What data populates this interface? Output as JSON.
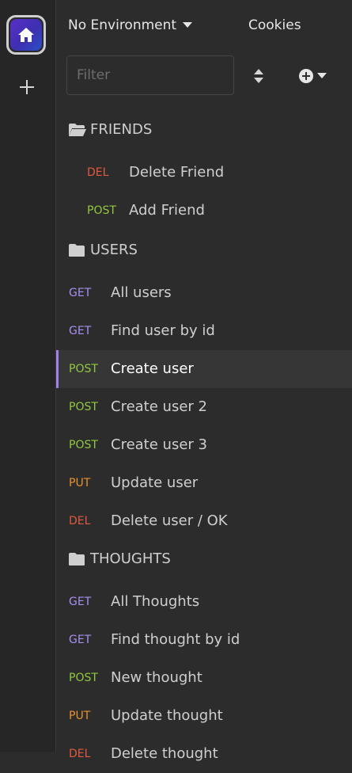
{
  "colors": {
    "GET": "#a98ff0",
    "POST": "#92c83e",
    "PUT": "#e8922c",
    "DEL": "#e2593f",
    "active_bar": "#9c82e8"
  },
  "header": {
    "environment": "No Environment",
    "cookies": "Cookies"
  },
  "filter": {
    "placeholder": "Filter",
    "value": ""
  },
  "folders": [
    {
      "name": "FRIENDS",
      "open": true,
      "requests": [
        {
          "method": "DEL",
          "name": "Delete Friend"
        },
        {
          "method": "POST",
          "name": "Add Friend"
        }
      ]
    },
    {
      "name": "USERS",
      "open": false,
      "requests": [
        {
          "method": "GET",
          "name": "All users"
        },
        {
          "method": "GET",
          "name": "Find user by id"
        },
        {
          "method": "POST",
          "name": "Create user",
          "active": true
        },
        {
          "method": "POST",
          "name": "Create user 2"
        },
        {
          "method": "POST",
          "name": "Create user 3"
        },
        {
          "method": "PUT",
          "name": "Update user"
        },
        {
          "method": "DEL",
          "name": "Delete user / OK"
        }
      ]
    },
    {
      "name": "THOUGHTS",
      "open": false,
      "requests": [
        {
          "method": "GET",
          "name": "All Thoughts"
        },
        {
          "method": "GET",
          "name": "Find thought by id"
        },
        {
          "method": "POST",
          "name": "New thought"
        },
        {
          "method": "PUT",
          "name": "Update thought"
        },
        {
          "method": "DEL",
          "name": "Delete thought"
        }
      ]
    }
  ]
}
